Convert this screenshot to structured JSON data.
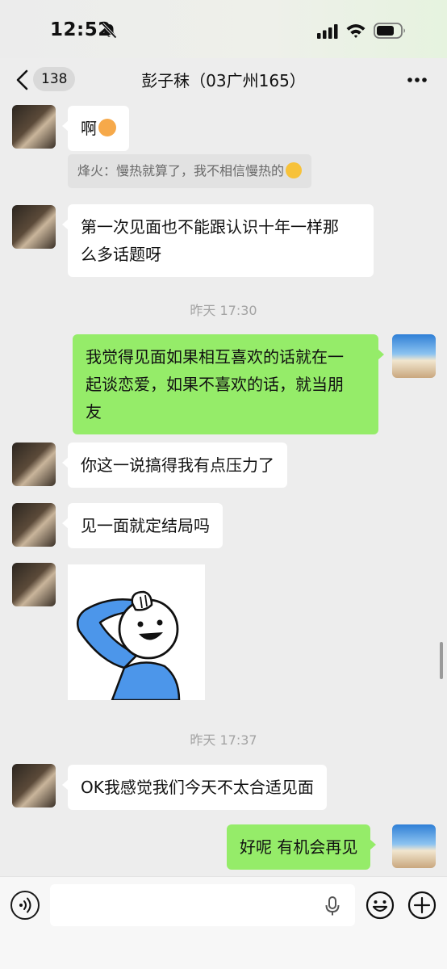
{
  "status": {
    "time": "12:52"
  },
  "nav": {
    "unread_count": "138",
    "title": "彭子秣（03广州165）"
  },
  "messages": [
    {
      "side": "left",
      "text": "啊",
      "emoji": "sad-face-emoji"
    },
    {
      "type": "quote",
      "text": "烽火：慢热就算了，我不相信慢热的",
      "emoji": "laughing-tears-emoji"
    },
    {
      "side": "left",
      "line1": "第一次见面也不能跟认识十年一样那",
      "line2": "么多话题呀"
    },
    {
      "type": "time",
      "text": "昨天 17:30"
    },
    {
      "side": "right",
      "line1": "我觉得见面如果相互喜欢的话就在一",
      "line2": "起谈恋爱，如果不喜欢的话，就当朋",
      "line3": "友"
    },
    {
      "side": "left",
      "text": "你这一说搞得我有点压力了"
    },
    {
      "side": "left",
      "text": "见一面就定结局吗"
    },
    {
      "side": "left",
      "type": "sticker",
      "sticker": "saluting-cartoon-sticker"
    },
    {
      "type": "time",
      "text": "昨天 17:37"
    },
    {
      "side": "left",
      "text": "OK我感觉我们今天不太合适见面"
    },
    {
      "side": "right",
      "text": "好呢 有机会再见"
    }
  ],
  "input": {
    "placeholder": ""
  },
  "icons": {
    "mute": "bell-slash-icon",
    "signal": "cellular-signal-icon",
    "wifi": "wifi-icon",
    "battery": "battery-icon",
    "back": "chevron-left-icon",
    "more": "more-dots-icon",
    "voice": "voice-input-icon",
    "mic": "microphone-icon",
    "emoji": "smiley-icon",
    "plus": "plus-circle-icon"
  },
  "colors": {
    "background": "#ededed",
    "bubble_self": "#95ec69",
    "bubble_other": "#ffffff",
    "timestamp": "#a3a3a3"
  }
}
